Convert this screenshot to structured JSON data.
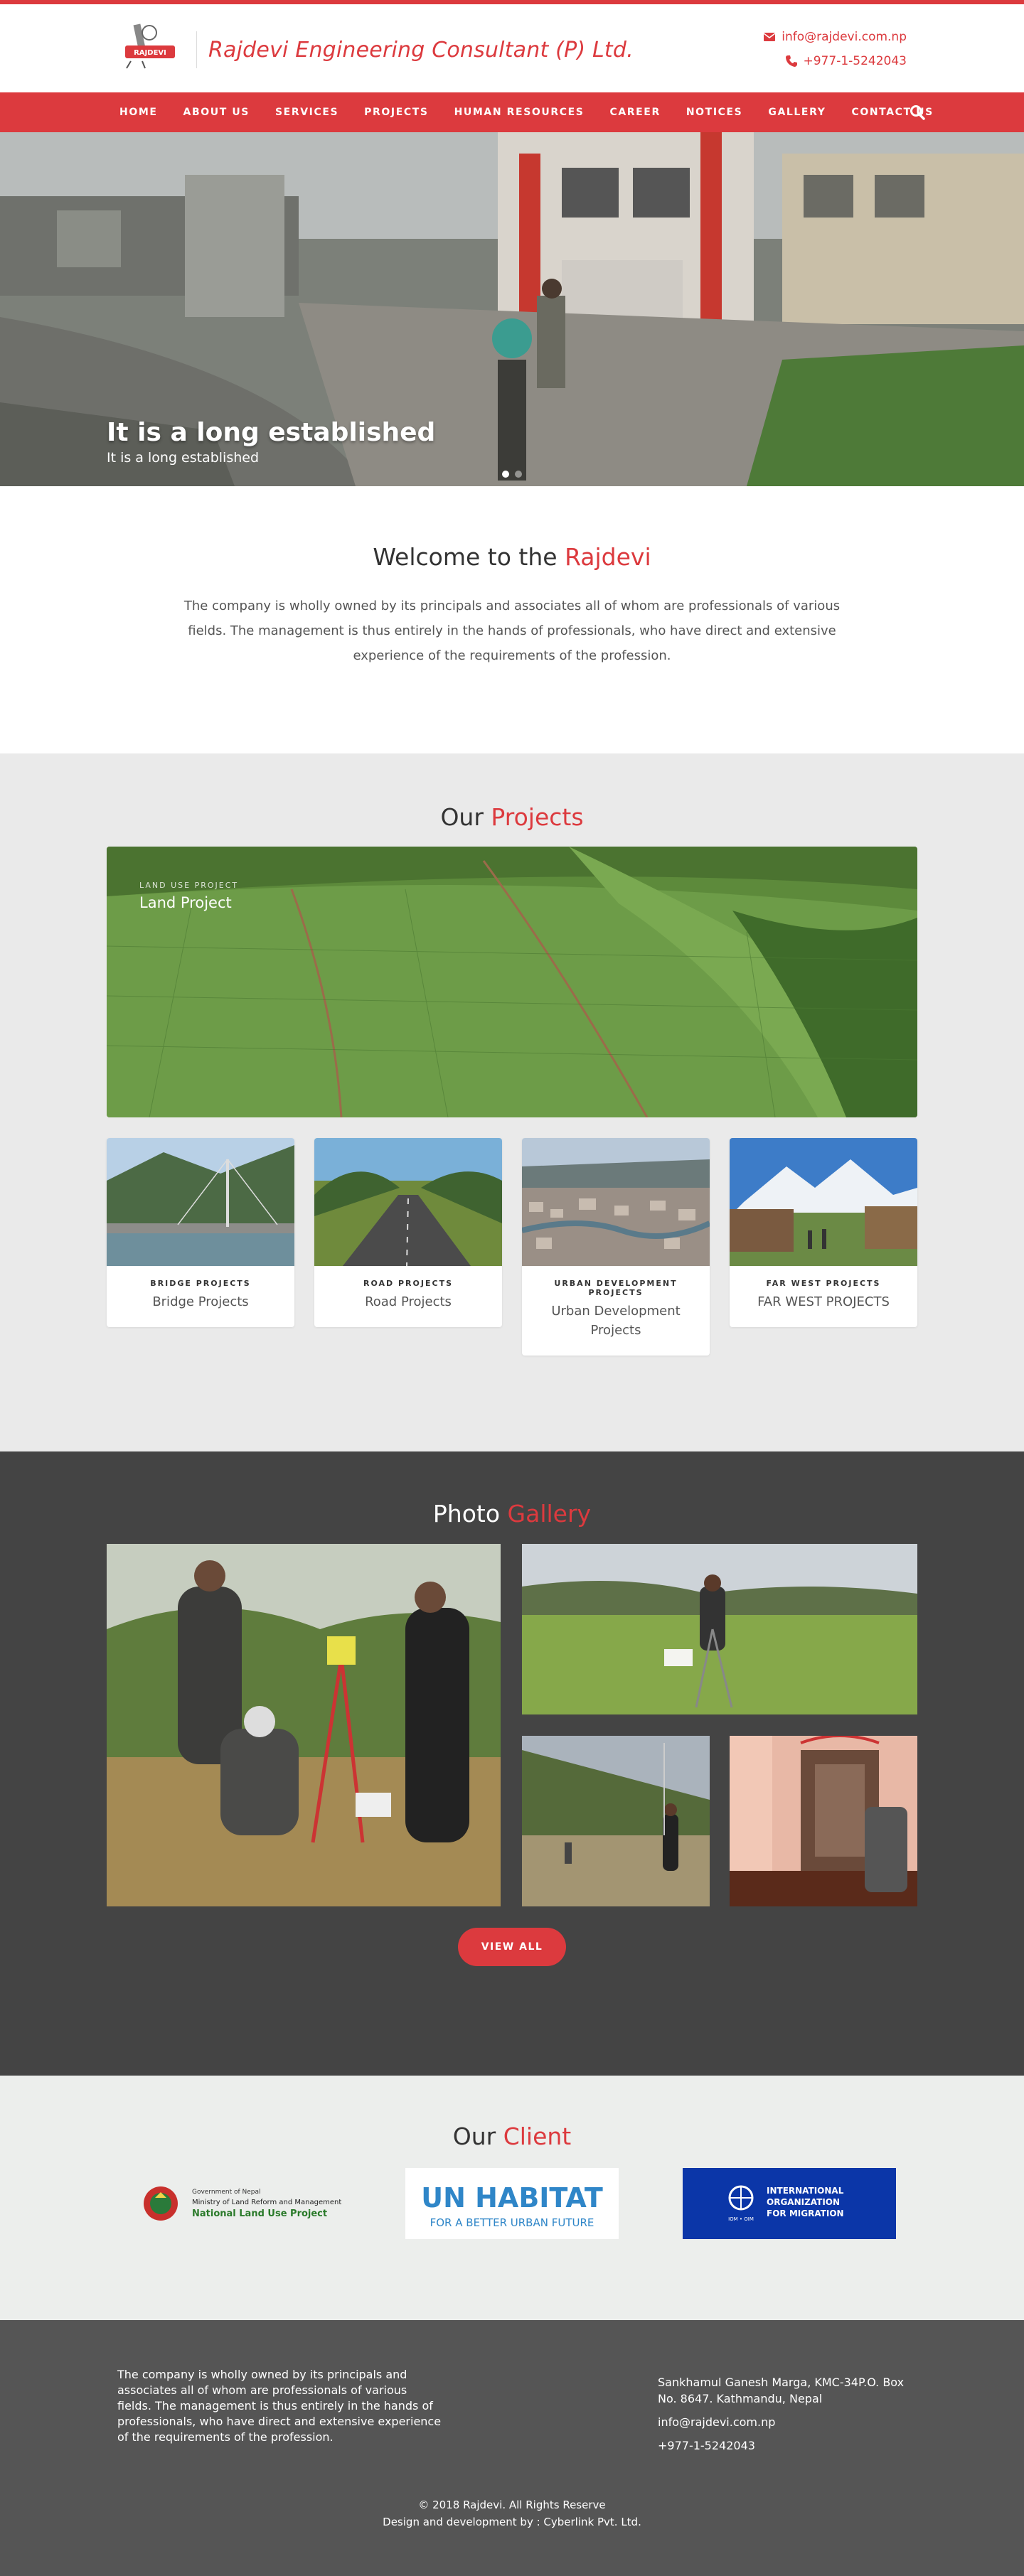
{
  "header": {
    "brand_name": "Rajdevi Engineering Consultant (P) Ltd.",
    "logo_text": "RAJDEVI",
    "email": "info@rajdevi.com.np",
    "phone": "+977-1-5242043"
  },
  "nav": {
    "items": [
      "HOME",
      "ABOUT US",
      "SERVICES",
      "PROJECTS",
      "HUMAN RESOURCES",
      "CAREER",
      "NOTICES",
      "GALLERY",
      "CONTACT US"
    ]
  },
  "hero": {
    "title": "It is a long established",
    "subtitle": "It is a long established",
    "slide_count": 2,
    "active_slide": 1
  },
  "welcome": {
    "title_prefix": "Welcome to the",
    "title_accent": "Rajdevi",
    "body": "The company is wholly owned by its principals and associates all of whom are professionals of various fields. The management is thus entirely in the hands of professionals, who have direct and extensive experience of the requirements of the profession."
  },
  "projects": {
    "title_prefix": "Our",
    "title_accent": "Projects",
    "featured": {
      "tag": "LAND USE PROJECT",
      "name": "Land Project"
    },
    "cards": [
      {
        "tag": "BRIDGE PROJECTS",
        "name": "Bridge Projects"
      },
      {
        "tag": "ROAD PROJECTS",
        "name": "Road Projects"
      },
      {
        "tag": "URBAN DEVELOPMENT PROJECTS",
        "name": "Urban Development Projects"
      },
      {
        "tag": "FAR WEST PROJECTS",
        "name": "FAR WEST PROJECTS"
      }
    ]
  },
  "gallery": {
    "title_prefix": "Photo",
    "title_accent": "Gallery",
    "view_all_label": "VIEW ALL"
  },
  "clients": {
    "title_prefix": "Our",
    "title_accent": "Client",
    "logos": [
      {
        "line1": "Government of Nepal",
        "line2": "Ministry of Land Reform and Management",
        "line3": "National Land Use Project"
      },
      {
        "line1": "UN HABITAT",
        "line2": "FOR A BETTER URBAN FUTURE"
      },
      {
        "line1": "INTERNATIONAL",
        "line2": "ORGANIZATION",
        "line3": "FOR MIGRATION",
        "line4": "IOM • OIM"
      }
    ]
  },
  "footer": {
    "about": "The company is wholly owned by its principals and associates all of whom are professionals of various fields. The management is thus entirely in the hands of professionals, who have direct and extensive experience of the requirements of the profession.",
    "address": "Sankhamul Ganesh Marga, KMC-34P.O. Box No. 8647. Kathmandu, Nepal",
    "email": "info@rajdevi.com.np",
    "phone": "+977-1-5242043",
    "copyright": "© 2018 Rajdevi. All Rights Reserve",
    "credit": "Design and development by : Cyberlink Pvt. Ltd."
  },
  "colors": {
    "accent": "#dc3a3e",
    "gallery_bg": "#444444",
    "footer_bg": "#555555",
    "projects_bg": "#eaeaea"
  }
}
